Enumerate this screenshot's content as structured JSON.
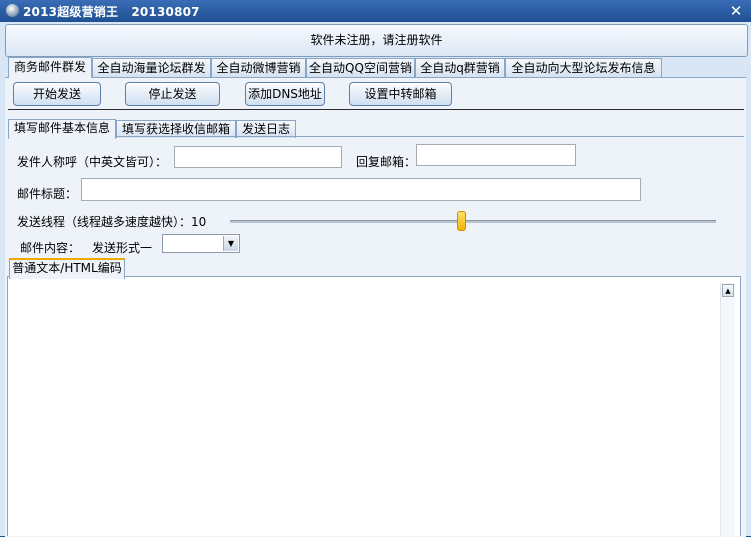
{
  "window": {
    "title": "2013超级营销王   20130807",
    "close_glyph": "✕"
  },
  "notice": "软件未注册，请注册软件",
  "main_tabs": [
    {
      "label": "商务邮件群发"
    },
    {
      "label": "全自动海量论坛群发"
    },
    {
      "label": "全自动微博营销"
    },
    {
      "label": "全自动QQ空间营销"
    },
    {
      "label": "全自动q群营销"
    },
    {
      "label": "全自动向大型论坛发布信息"
    }
  ],
  "toolbar": {
    "start": "开始发送",
    "stop": "停止发送",
    "add_dns": "添加DNS地址",
    "relay": "设置中转邮箱"
  },
  "sub_tabs": [
    {
      "label": "填写邮件基本信息"
    },
    {
      "label": "填写获选择收信邮箱"
    },
    {
      "label": "发送日志"
    }
  ],
  "form": {
    "sender_label": "发件人称呼（中英文皆可）：",
    "sender_value": "",
    "reply_label": "回复邮箱：",
    "reply_value": "",
    "subject_label": "邮件标题：",
    "subject_value": "",
    "threads_label": "发送线程（线程越多速度越快）：10",
    "threads_value": 10,
    "content_label": "邮件内容：",
    "mode_label": "发送形式一",
    "mode_value": ""
  },
  "editor_tab": "普通文本/HTML编码",
  "icons": {
    "app": "app-icon",
    "close": "close-icon",
    "dropdown": "chevron-down-icon",
    "scroll_up": "scroll-up-icon"
  },
  "colors": {
    "titlebar": "#1f4f93",
    "panel": "#eef3fa",
    "slider_thumb": "#f2b400"
  }
}
